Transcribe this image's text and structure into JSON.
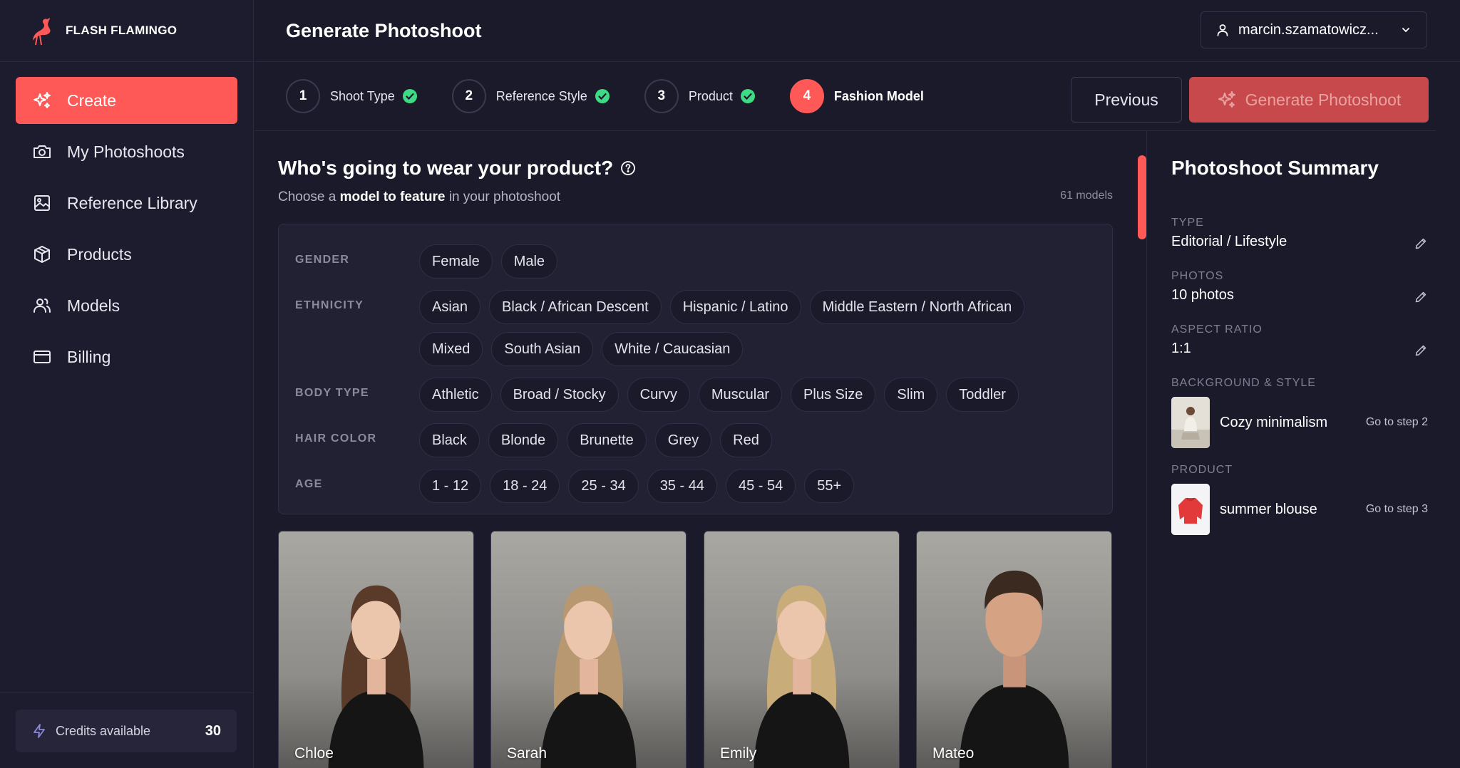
{
  "brand": {
    "name": "FLASH FLAMINGO"
  },
  "colors": {
    "accent": "#ff5957",
    "bg": "#1b1a2b",
    "panel": "#222134",
    "check": "#3ddc84"
  },
  "sidebar": {
    "items": [
      {
        "label": "Create",
        "icon": "sparkles-icon",
        "active": true
      },
      {
        "label": "My Photoshoots",
        "icon": "camera-icon"
      },
      {
        "label": "Reference Library",
        "icon": "image-icon"
      },
      {
        "label": "Products",
        "icon": "box-icon"
      },
      {
        "label": "Models",
        "icon": "users-icon"
      },
      {
        "label": "Billing",
        "icon": "credit-card-icon"
      }
    ],
    "credits": {
      "label": "Credits available",
      "value": "30"
    }
  },
  "header": {
    "title": "Generate Photoshoot",
    "user": "marcin.szamatowicz..."
  },
  "steps": [
    {
      "num": "1",
      "label": "Shoot Type",
      "done": true
    },
    {
      "num": "2",
      "label": "Reference Style",
      "done": true
    },
    {
      "num": "3",
      "label": "Product",
      "done": true
    },
    {
      "num": "4",
      "label": "Fashion Model",
      "active": true
    }
  ],
  "actions": {
    "previous": "Previous",
    "generate": "Generate Photoshoot"
  },
  "main": {
    "title": "Who's going to wear your product?",
    "subtitle_pre": "Choose a ",
    "subtitle_bold": "model to feature",
    "subtitle_post": " in your photoshoot",
    "count": "61 models"
  },
  "filters": {
    "gender": {
      "label": "GENDER",
      "options": [
        "Female",
        "Male"
      ]
    },
    "ethnicity": {
      "label": "ETHNICITY",
      "options": [
        "Asian",
        "Black / African Descent",
        "Hispanic / Latino",
        "Middle Eastern / North African",
        "Mixed",
        "South Asian",
        "White / Caucasian"
      ]
    },
    "body": {
      "label": "BODY TYPE",
      "options": [
        "Athletic",
        "Broad / Stocky",
        "Curvy",
        "Muscular",
        "Plus Size",
        "Slim",
        "Toddler"
      ]
    },
    "hair": {
      "label": "HAIR COLOR",
      "options": [
        "Black",
        "Blonde",
        "Brunette",
        "Grey",
        "Red"
      ]
    },
    "age": {
      "label": "AGE",
      "options": [
        "1 - 12",
        "18 - 24",
        "25 - 34",
        "35 - 44",
        "45 - 54",
        "55+"
      ]
    }
  },
  "models": [
    {
      "name": "Chloe",
      "hair": "#5a3a28"
    },
    {
      "name": "Sarah",
      "hair": "#b79870"
    },
    {
      "name": "Emily",
      "hair": "#c8ac7a"
    },
    {
      "name": "Mateo",
      "hair": "#3a2a20"
    }
  ],
  "summary": {
    "title": "Photoshoot Summary",
    "type": {
      "label": "TYPE",
      "value": "Editorial / Lifestyle"
    },
    "photos": {
      "label": "PHOTOS",
      "value": "10 photos"
    },
    "ratio": {
      "label": "ASPECT RATIO",
      "value": "1:1"
    },
    "background": {
      "label": "BACKGROUND & STYLE",
      "value": "Cozy minimalism",
      "link": "Go to step 2"
    },
    "product": {
      "label": "PRODUCT",
      "value": "summer blouse",
      "link": "Go to step 3"
    }
  }
}
